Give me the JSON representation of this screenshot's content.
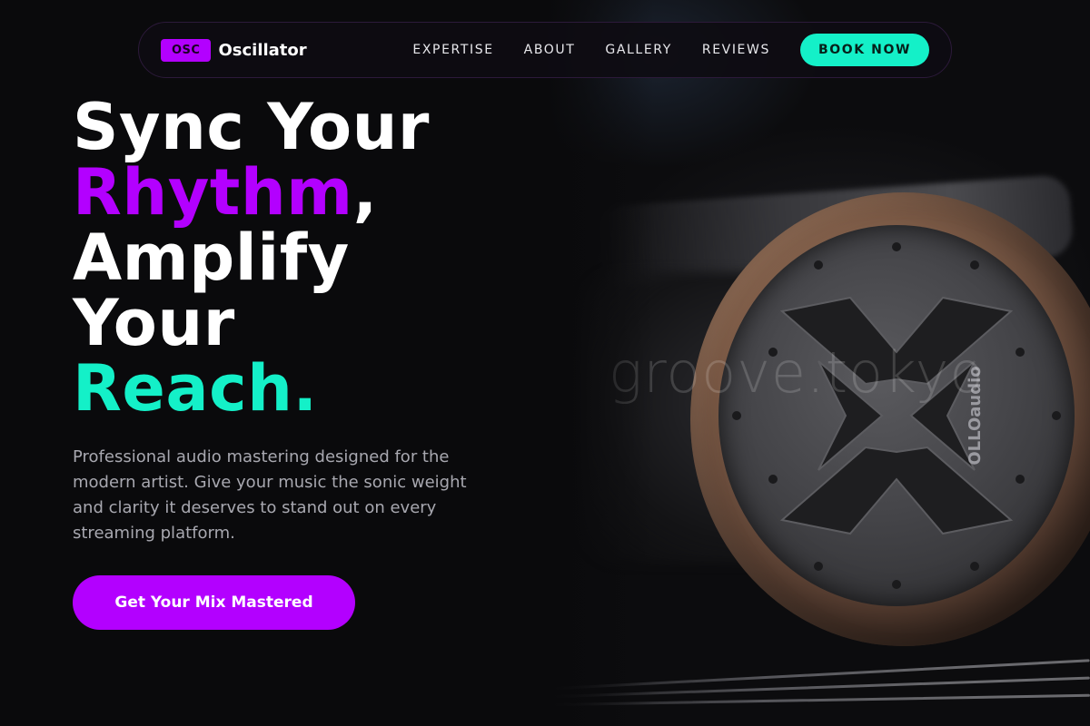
{
  "brand": {
    "badge": "OSC",
    "name": "Oscillator"
  },
  "nav": {
    "links": [
      "EXPERTISE",
      "ABOUT",
      "GALLERY",
      "REVIEWS"
    ],
    "cta": "BOOK NOW"
  },
  "hero": {
    "headline": {
      "line1": "Sync Your",
      "rhythm": "Rhythm",
      "comma": ",",
      "line3": "Amplify",
      "line4": "Your",
      "reach": "Reach."
    },
    "description": "Professional audio mastering designed for the modern artist. Give your music the sonic weight and clarity it deserves to stand out on every streaming platform.",
    "cta": "Get Your Mix Mastered",
    "image_watermark": "groove.tokyo",
    "image_brand_text": "OLLOaudio"
  },
  "colors": {
    "background": "#0a0a0c",
    "accent_purple": "#b300ff",
    "accent_teal": "#14f0c8",
    "text_muted": "#a8a8b0"
  },
  "icons": {
    "hero_image": "headphone-earcup-photo"
  }
}
